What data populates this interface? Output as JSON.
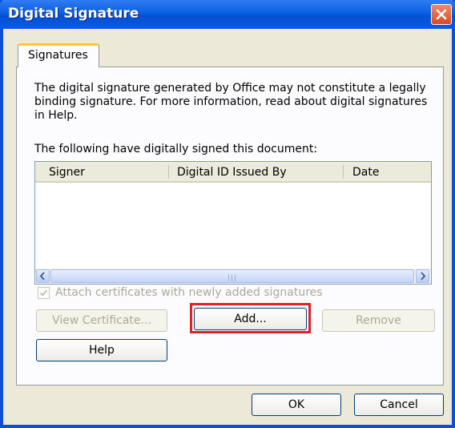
{
  "window": {
    "title": "Digital Signature"
  },
  "tabs": [
    {
      "label": "Signatures"
    }
  ],
  "info_text": "The digital signature generated by Office may not constitute a legally binding signature. For more information, read about digital signatures in Help.",
  "signed_label": "The following have digitally signed this document:",
  "list": {
    "columns": [
      "Signer",
      "Digital ID Issued By",
      "Date"
    ],
    "rows": []
  },
  "checkbox": {
    "label": "Attach certificates with newly added signatures",
    "checked": true,
    "enabled": false
  },
  "buttons": {
    "view_certificate": "View Certificate...",
    "add": "Add...",
    "remove": "Remove",
    "help": "Help",
    "ok": "OK",
    "cancel": "Cancel"
  },
  "highlight_color": "#e2202a",
  "titlebar_color": "#0a5ae6"
}
